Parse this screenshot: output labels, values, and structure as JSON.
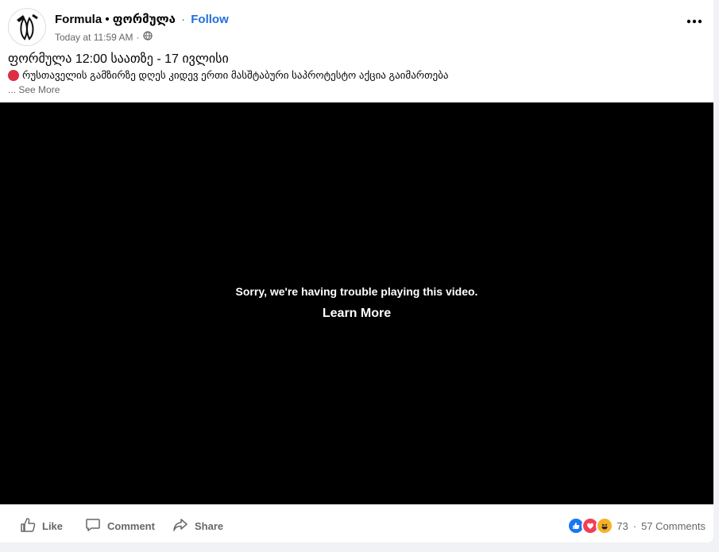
{
  "post": {
    "page_name": "Formula • ფორმულა",
    "dot": "·",
    "follow_label": "Follow",
    "timestamp": "Today at 11:59 AM",
    "meta_sep": "·",
    "title": "ფორმულა 12:00 საათზე - 17 ივლისი",
    "body": "რუსთაველის გამზირზე დღეს კიდევ ერთი მასშტაბური საპროტესტო აქცია გაიმართება",
    "see_more": "... See More"
  },
  "video": {
    "error_message": "Sorry, we're having trouble playing this video.",
    "learn_more": "Learn More"
  },
  "actions": {
    "like": "Like",
    "comment": "Comment",
    "share": "Share"
  },
  "stats": {
    "reaction_count": "73",
    "sep": "·",
    "comments": "57 Comments"
  },
  "icons": [
    "globe-icon",
    "more-options-icon",
    "like-icon",
    "comment-icon",
    "share-icon",
    "like-reaction-icon",
    "love-reaction-icon",
    "haha-reaction-icon"
  ],
  "colors": {
    "accent": "#216fdb",
    "like": "#1877f2",
    "love": "#f33e58",
    "haha": "#f7b125"
  }
}
